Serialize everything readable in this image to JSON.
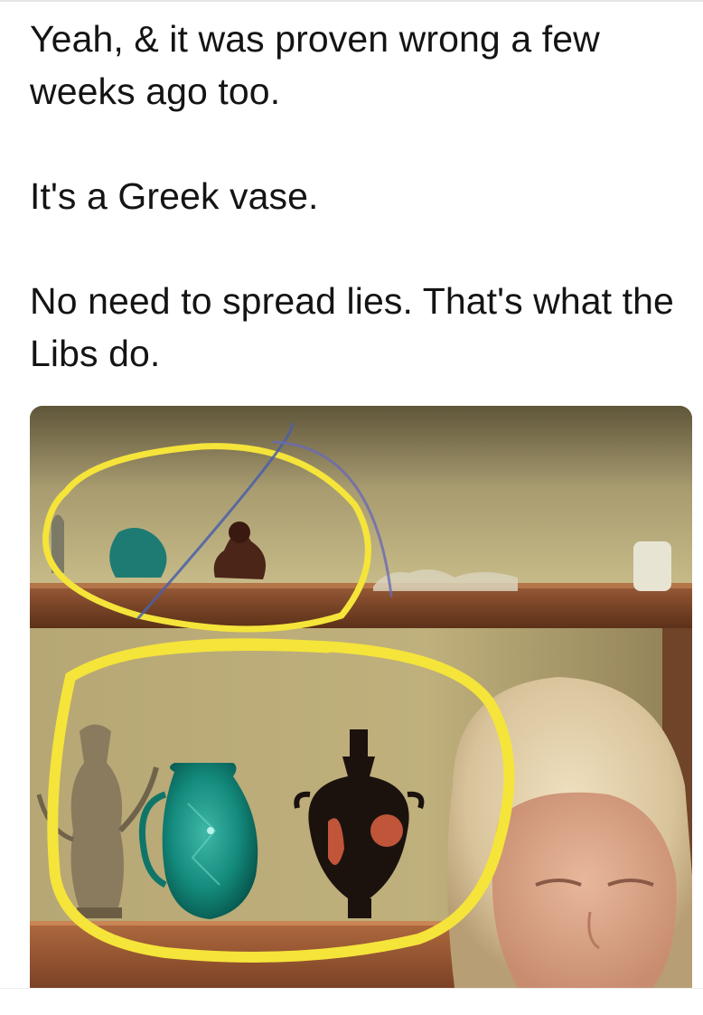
{
  "post": {
    "paragraphs": [
      "Yeah, & it was proven wrong a few weeks ago too.",
      "It's a Greek vase.",
      "No need to spread lies. That's what the Libs do."
    ]
  },
  "photo": {
    "highlight_color": "#f5e43a"
  }
}
